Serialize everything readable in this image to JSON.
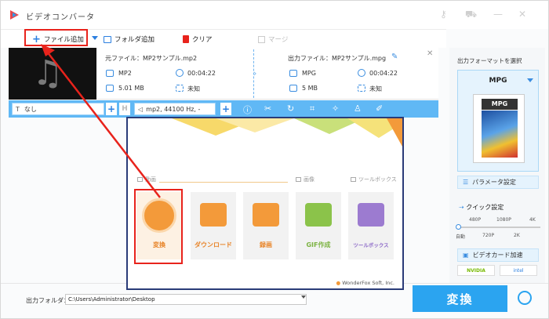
{
  "app": {
    "title": "ビデオコンバータ"
  },
  "toolbar": {
    "add_file": "ファイル追加",
    "add_folder": "フォルダ追加",
    "clear": "クリア",
    "merge": "マージ"
  },
  "file": {
    "source_label": "元ファイル：",
    "source_name": "MP2サンプル.mp2",
    "source_format": "MP2",
    "source_duration": "00:04:22",
    "source_size": "5.01 MB",
    "source_resolution": "未知",
    "output_label": "出力ファイル：",
    "output_name": "MP2サンプル.mpg",
    "output_format": "MPG",
    "output_duration": "00:04:22",
    "output_size": "5 MB",
    "output_resolution": "未知"
  },
  "editbar": {
    "subtitle": "なし",
    "audio": "mp2, 44100 Hz, -"
  },
  "right_panel": {
    "title": "出力フォーマットを選択",
    "format": "MPG",
    "format_badge": "MPG",
    "params": "パラメータ設定",
    "quick": "クイック設定",
    "quality_top": [
      "480P",
      "1080P",
      "4K"
    ],
    "quality_bottom": [
      "自動",
      "720P",
      "2K"
    ],
    "gpu": "ビデオカード加速",
    "gpu_vendors": [
      "NVIDIA",
      "intel"
    ]
  },
  "bottom": {
    "output_folder_label": "出力フォルダ：",
    "output_path": "C:\\Users\\Administrator\\Desktop",
    "convert": "変換"
  },
  "launcher": {
    "section_video": "動画",
    "section_image": "画像",
    "section_tools": "ツールボックス",
    "cards": [
      "変換",
      "ダウンロード",
      "録画",
      "GIF作成",
      "ツールボックス"
    ],
    "credit": "WonderFox Soft, Inc."
  },
  "colors": {
    "accent": "#2ba4f0",
    "highlight": "#e8231c",
    "orange": "#f39a3a"
  }
}
